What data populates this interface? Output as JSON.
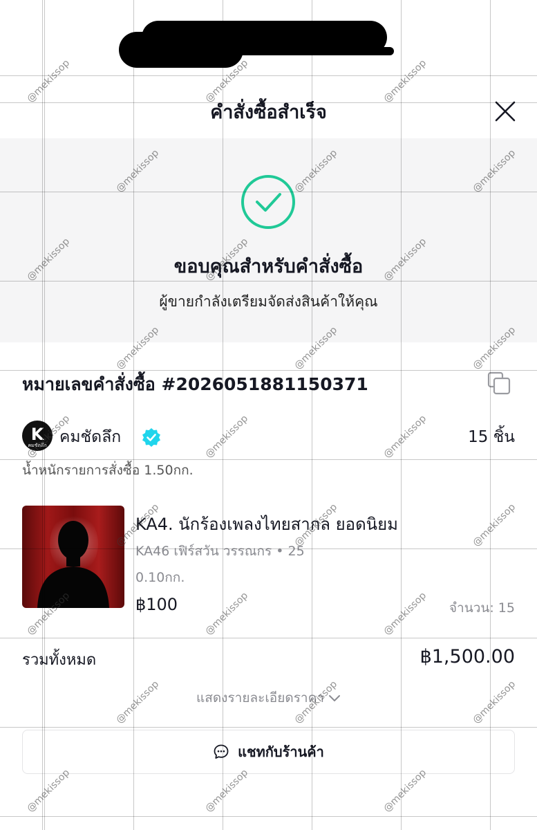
{
  "header": {
    "title": "คำสั่งซื้อสำเร็จ",
    "close_icon": "close-icon"
  },
  "hero": {
    "icon": "check-circle-icon",
    "accent_color": "#20c997",
    "title": "ขอบคุณสำหรับคำสั่งซื้อ",
    "subtitle": "ผู้ขายกำลังเตรียมจัดส่งสินค้าให้คุณ"
  },
  "order": {
    "number_label": "หมายเลขคำสั่งซื้อ #2026051881150371",
    "copy_icon": "copy-icon"
  },
  "shop": {
    "logo_letter": "K",
    "logo_caption": "คมชัดลึก",
    "name": "คมชัดลึก",
    "verified_icon": "verified-badge-icon",
    "item_count": "15 ชิ้น",
    "weight": "น้ำหนักรายการสั่งซื้อ 1.50กก."
  },
  "product": {
    "title": "KA4. นักร้องเพลงไทยสากล ยอดนิยม",
    "variant": "KA46 เฟิร์สวัน วรรณกร • 25",
    "weight": "0.10กก.",
    "price": "฿100",
    "quantity": "จำนวน: 15"
  },
  "summary": {
    "total_label": "รวมทั้งหมด",
    "total_value": "฿1,500.00",
    "details_link": "แสดงรายละเอียดราคา"
  },
  "chat": {
    "icon": "chat-bubble-icon",
    "label": "แชทกับร้านค้า"
  },
  "watermark_text": "@mekissop",
  "colors": {
    "text": "#161823",
    "muted": "#8a8b91",
    "hero_bg": "#f5f5f6",
    "verified": "#20d5ec"
  }
}
